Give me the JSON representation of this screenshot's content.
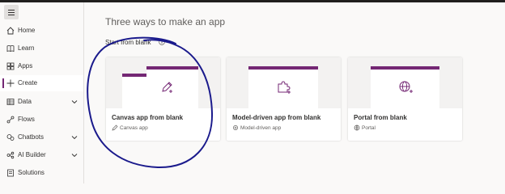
{
  "page": {
    "title": "Three ways to make an app",
    "section_label": "Start from blank"
  },
  "sidebar": {
    "items": [
      {
        "label": "Home"
      },
      {
        "label": "Learn"
      },
      {
        "label": "Apps"
      },
      {
        "label": "Create"
      },
      {
        "label": "Data"
      },
      {
        "label": "Flows"
      },
      {
        "label": "Chatbots"
      },
      {
        "label": "AI Builder"
      },
      {
        "label": "Solutions"
      }
    ]
  },
  "cards": [
    {
      "title": "Canvas app from blank",
      "subtitle": "Canvas app",
      "icon": "pencil-icon"
    },
    {
      "title": "Model-driven app from blank",
      "subtitle": "Model-driven app",
      "icon": "puzzle-icon"
    },
    {
      "title": "Portal from blank",
      "subtitle": "Portal",
      "icon": "globe-icon"
    }
  ],
  "colors": {
    "accent": "#742774",
    "annotation": "#1a1a8c"
  }
}
